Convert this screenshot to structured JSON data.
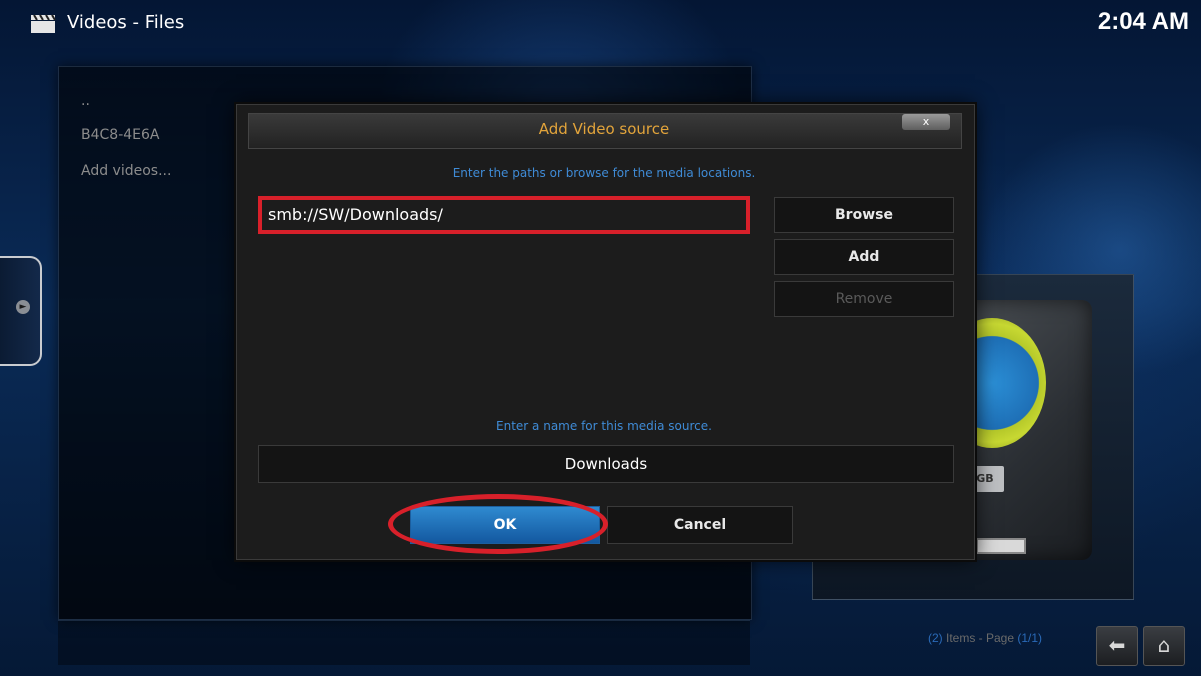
{
  "header": {
    "section": "Videos",
    "separator": " - ",
    "subsection": "Files",
    "clock": "2:04 AM"
  },
  "file_list": {
    "items": [
      "..",
      "B4C8-4E6A",
      "Add videos..."
    ]
  },
  "dialog": {
    "title": "Add Video source",
    "close_label": "x",
    "paths_hint": "Enter the paths or browse for the media locations.",
    "paths": [
      "smb://SW/Downloads/"
    ],
    "browse_label": "Browse",
    "add_label": "Add",
    "remove_label": "Remove",
    "name_hint": "Enter a name for this media source.",
    "name_value": "Downloads",
    "ok_label": "OK",
    "cancel_label": "Cancel"
  },
  "thumbnail": {
    "capacity_label": "GB"
  },
  "status": {
    "count": "(2)",
    "items_text": " Items - Page ",
    "page": "(1/1)"
  },
  "colors": {
    "accent_title": "#e2a43b",
    "hint_blue": "#3f8bd6",
    "highlight_red": "#d8202a",
    "ok_blue": "#2f8ad0"
  },
  "icons": {
    "header": "clapperboard-icon",
    "side_tab": "circle-arrow-icon",
    "back": "arrow-left-icon",
    "home": "home-icon"
  }
}
